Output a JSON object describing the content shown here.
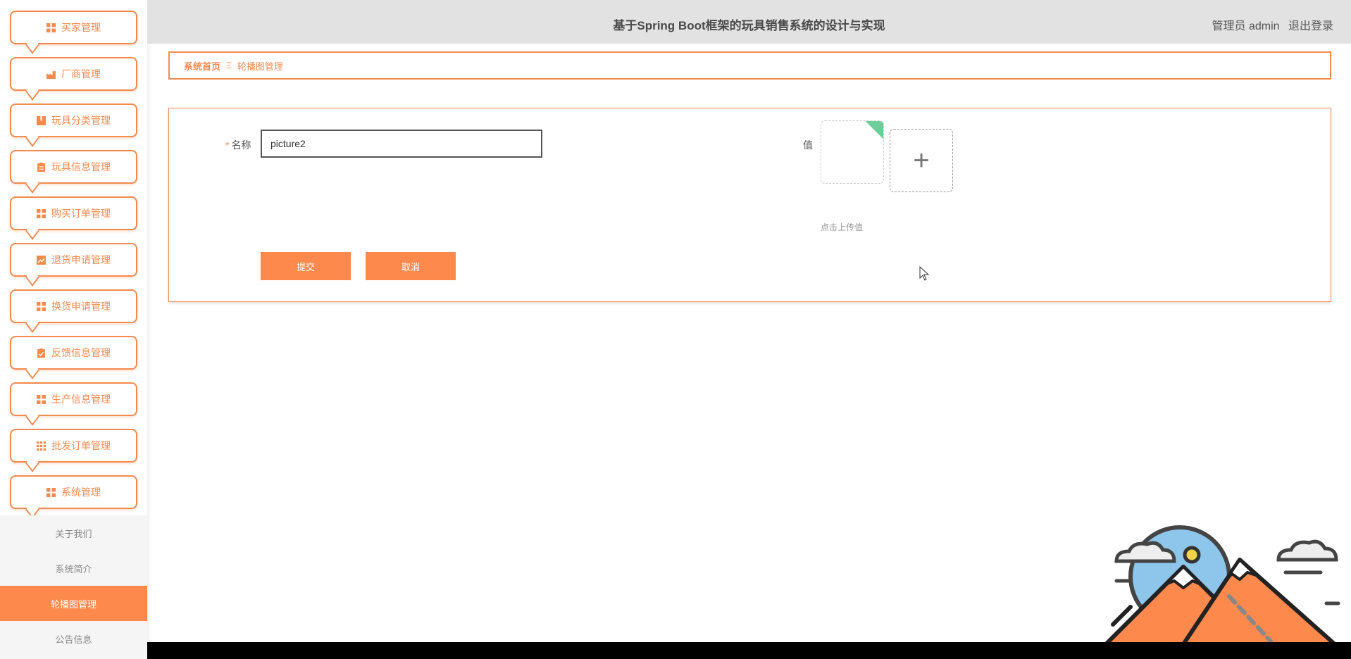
{
  "header": {
    "title": "基于Spring Boot框架的玩具销售系统的设计与实现",
    "user_role": "管理员 admin",
    "logout": "退出登录"
  },
  "sidebar": {
    "items": [
      {
        "label": "买家管理",
        "icon": "grid-icon"
      },
      {
        "label": "厂商管理",
        "icon": "factory-icon"
      },
      {
        "label": "玩具分类管理",
        "icon": "book-icon"
      },
      {
        "label": "玩具信息管理",
        "icon": "clipboard-icon"
      },
      {
        "label": "购买订单管理",
        "icon": "grid-icon"
      },
      {
        "label": "退货申请管理",
        "icon": "chart-icon"
      },
      {
        "label": "换货申请管理",
        "icon": "grid-icon"
      },
      {
        "label": "反馈信息管理",
        "icon": "clipboard-check-icon"
      },
      {
        "label": "生产信息管理",
        "icon": "grid-icon"
      },
      {
        "label": "批发订单管理",
        "icon": "apps-icon"
      },
      {
        "label": "系统管理",
        "icon": "grid-icon"
      }
    ],
    "submenu": [
      {
        "label": "关于我们"
      },
      {
        "label": "系统简介"
      },
      {
        "label": "轮播图管理",
        "active": true
      },
      {
        "label": "公告信息"
      }
    ]
  },
  "breadcrumb": {
    "home": "系统首页",
    "separator": "Ξ",
    "current": "轮播图管理"
  },
  "form": {
    "name_required_mark": "*",
    "name_label": "名称",
    "name_value": "picture2",
    "value_label": "值",
    "upload_plus": "+",
    "upload_tip": "点击上传值",
    "submit_label": "提交",
    "cancel_label": "取消"
  },
  "colors": {
    "accent": "#fd8a4c",
    "header_bg": "#e2e2e2",
    "thumb_corner": "#6ccf9a"
  }
}
